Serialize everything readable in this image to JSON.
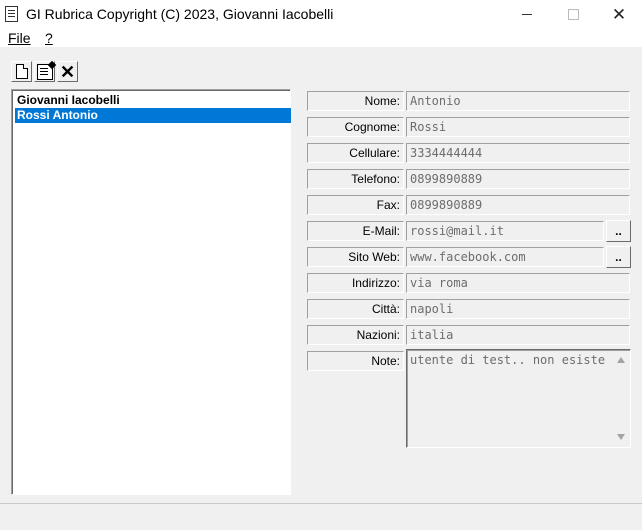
{
  "window": {
    "title": "GI Rubrica Copyright (C) 2023, Giovanni Iacobelli",
    "minimize_icon": "minimize-icon",
    "maximize_icon": "maximize-icon",
    "close_icon": "close-icon",
    "close_glyph": "✕"
  },
  "menu": {
    "file": {
      "label": "File"
    },
    "help": {
      "label": "?"
    }
  },
  "toolbar": {
    "new_icon": "new-document-icon",
    "edit_icon": "edit-document-icon",
    "delete_icon": "delete-icon",
    "delete_glyph": "✕"
  },
  "contacts": [
    {
      "name": "Giovanni Iacobelli",
      "selected": false
    },
    {
      "name": "Rossi Antonio",
      "selected": true
    }
  ],
  "form": {
    "nome": {
      "label": "Nome:",
      "value": "Antonio"
    },
    "cognome": {
      "label": "Cognome:",
      "value": "Rossi"
    },
    "cellulare": {
      "label": "Cellulare:",
      "value": "3334444444"
    },
    "telefono": {
      "label": "Telefono:",
      "value": "0899890889"
    },
    "fax": {
      "label": "Fax:",
      "value": "0899890889"
    },
    "email": {
      "label": "E-Mail:",
      "value": "rossi@mail.it",
      "button": ".."
    },
    "sito_web": {
      "label": "Sito Web:",
      "value": "www.facebook.com",
      "button": ".."
    },
    "indirizzo": {
      "label": "Indirizzo:",
      "value": "via roma"
    },
    "citta": {
      "label": "Città:",
      "value": "napoli"
    },
    "nazioni": {
      "label": "Nazioni:",
      "value": "italia"
    },
    "note": {
      "label": "Note:",
      "value": "utente di test.. non esiste"
    }
  },
  "colors": {
    "selection": "#0078d7",
    "readonly_text": "#6d6d6d"
  }
}
